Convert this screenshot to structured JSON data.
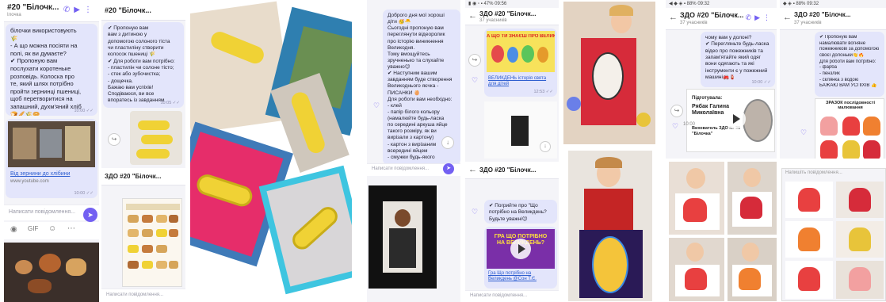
{
  "colors": {
    "viber_purple": "#7360f2",
    "bubble": "#e3e5fb",
    "braid_yellow": "#f0d235"
  },
  "panel1": {
    "title": "#20 \"Білочк...",
    "sub": "Ілочка",
    "bubble1": [
      "білочки використовують",
      "🌾",
      "- А що можна посіяти на",
      "полі, як ви думаєте?",
      "✔ Пропоную вам",
      "послухати коротеньке",
      "розповідь. Колоска про",
      "те, який шлях потрібно",
      "пройти зернинці пшениці,",
      "щоб перетворитися на",
      "запашний, духм'яний хліб",
      "🍞🥖🌾🥯"
    ],
    "bubble1_time": "10:00 ✓✓",
    "link": "Від зернини до хлібини",
    "link_sub": "www.youtube.com",
    "link_time": "10:00 ✓✓",
    "input_placeholder": "Написати повідомлення..."
  },
  "panel2": {
    "title": "#20 \"Білочк...",
    "bubble1": [
      "✔ Пропоную вам",
      "вам з дитиною у",
      "допомогою солоного тіста",
      "чи пластиліну створити",
      "колосок пшениці 🌾",
      "",
      "✔ Для роботи вам потрібно:",
      "- пластилін чи солоне тісто;",
      "- стек або зубочистка;",
      "- дощечка.",
      "",
      "Бажаю вам успіхів!",
      "Сподіваюся, ви все",
      "впоратесь із завданням"
    ],
    "bubble1_time": "10:05 ✓✓",
    "title2": "ЗДО #20 \"Білочк...",
    "input_placeholder": "Написати повідомлення..."
  },
  "panel3": {
    "bubble1": [
      "Доброго дня мої хороші",
      "діти 🥳🐣",
      "Сьогодні пропоную вам",
      "переглянути відеоролик",
      "про історію виникнення",
      "Великодня.",
      "Тому вмощуйтесь",
      "зручненько та слухайте",
      "уважно😉",
      "",
      "✔ Наступним вашим",
      "завданням буде створення",
      "Великоднього яєчка -",
      "ПИСАНКИ 🥚",
      "Для роботи вам необхідно:",
      "- клей",
      "- папір білого кольору",
      "(намалюйте будь-ласка",
      "по середині аркуша яйце",
      "такого розміру, як ви",
      "вирізали з картону)",
      "- картон з вирізаним",
      "всередині яйцем",
      "- смужки будь-якого"
    ],
    "input_placeholder": "Написати повідомлення...",
    "title2": "ЗДО #20 \"Білочк...",
    "time1": "12:53"
  },
  "panel4": {
    "title": "ЗДО #20 \"Білочк...",
    "sub": "37 учасників",
    "video_title": "А ЩО ТИ ЗНАЄШ ПРО ВЕЛИКДЕНЬ",
    "link": "ВЕЛИКДЕНЬ історія свята для дітей",
    "link_time": "12:53 ✓✓",
    "title2": "ЗДО #20 \"Білочк...",
    "bubble2": [
      "✔ Погрийте про \"Що",
      "потрібно на Великдень?",
      "Будьте уважні😉"
    ],
    "video2_title": "ГРА ЩО ПОТРІБНО НА ВЕЛИКДЕНЬ?",
    "link2": "Гра Що потрібно на Великдень @Сон Т.Є.",
    "input_placeholder": "Написати повідомлення..."
  },
  "panel5": {
    "title": "ЗДО #20 \"Білочк...",
    "sub": "37 учасників",
    "bubble1": [
      "чому вам у долоні?",
      "✔ Перегляньте будь-ласка",
      "відео про пожежників та",
      "запам'ятайте який одяг",
      "вони одягають та які",
      "інструменти є у пожежний",
      "машині🚒🧯"
    ],
    "bubble1_time": "10:00 ✓✓",
    "card_title": "Підготувала:",
    "card_name": "Рябак Галина Миколаївна",
    "card_role": "Вихователь ЗДО № 20 \"Білочка\"",
    "time_badge": "10:00"
  },
  "panel6": {
    "title": "ЗДО #20 \"Білочк...",
    "sub": "37 учасників",
    "bubble1": [
      "✔ Пропоную вам",
      "намалювати вогняне",
      "пожежникові за допомогою",
      "своєї долоньки👋🔥",
      "",
      "Для роботи вам потрібно:",
      "- фарба",
      "- пензлик",
      "- склянка з водою",
      "БАЖАЮ ВАМ УСПІХІВ 👍"
    ],
    "sample_title": "ЗРАЗОК послідовності малювання",
    "input_placeholder": "Напишіть повідомлення..."
  }
}
